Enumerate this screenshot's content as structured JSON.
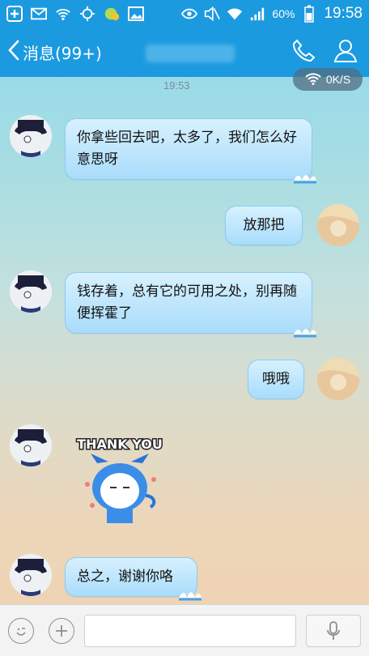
{
  "status_bar": {
    "battery": "60%",
    "time": "19:58",
    "icons": [
      "add-icon",
      "mail-icon",
      "wifi-signal-icon",
      "location-icon",
      "game-icon",
      "image-icon",
      "eye-icon",
      "mute-icon",
      "wifi-icon",
      "cell-signal-icon",
      "battery-icon"
    ]
  },
  "header": {
    "back_label": "消息(99+)",
    "icons": [
      "phone-icon",
      "profile-icon"
    ]
  },
  "speed": {
    "label": "0K/S"
  },
  "timestamp": "19:53",
  "messages": [
    {
      "side": "left",
      "text": "你拿些回去吧，太多了，我们怎么好意思呀"
    },
    {
      "side": "right",
      "text": "放那把"
    },
    {
      "side": "left",
      "text": "钱存着，总有它的可用之处，别再随便挥霍了"
    },
    {
      "side": "right",
      "text": "哦哦"
    },
    {
      "side": "left",
      "type": "sticker",
      "sticker_text": "THANK YOU"
    },
    {
      "side": "left",
      "text": "总之，谢谢你咯"
    }
  ],
  "input_bar": {
    "placeholder": "",
    "icons": [
      "emoji-icon",
      "plus-icon",
      "microphone-icon"
    ]
  },
  "colors": {
    "brand_blue": "#1b9ae0",
    "bubble_top": "#d7f1fe",
    "bubble_bottom": "#a9dcfb"
  }
}
